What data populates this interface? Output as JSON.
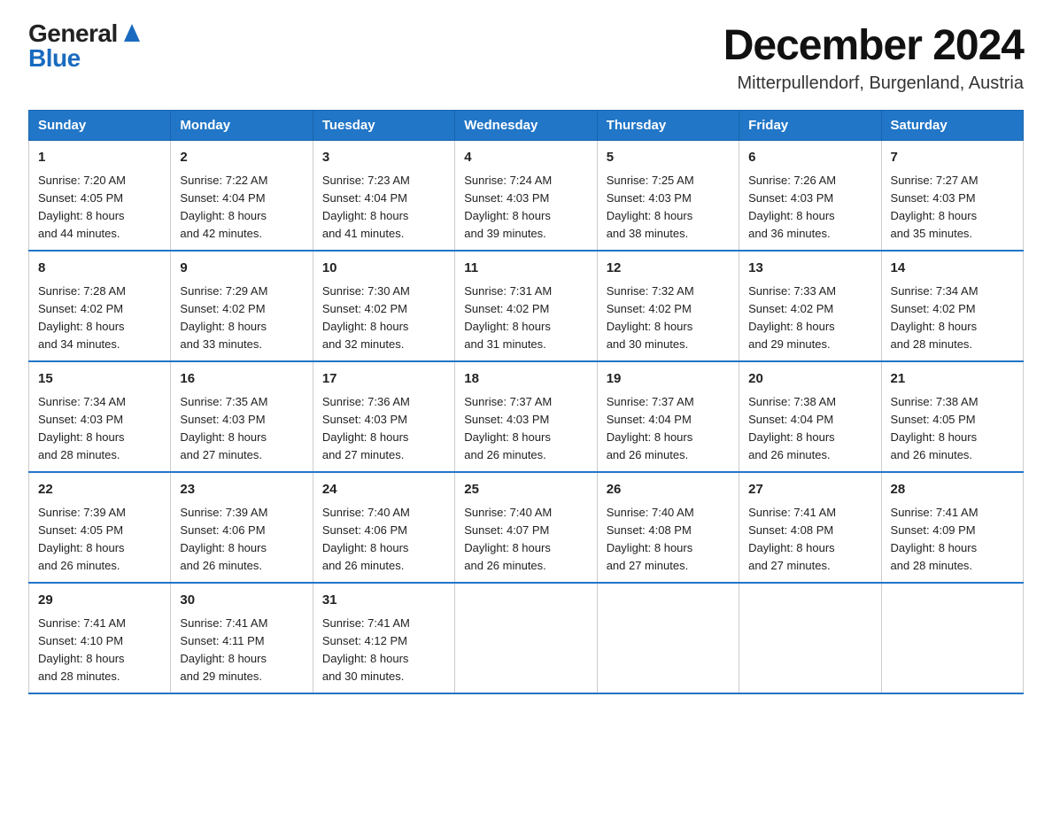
{
  "logo": {
    "general": "General",
    "blue": "Blue"
  },
  "title": "December 2024",
  "subtitle": "Mitterpullendorf, Burgenland, Austria",
  "weekdays": [
    "Sunday",
    "Monday",
    "Tuesday",
    "Wednesday",
    "Thursday",
    "Friday",
    "Saturday"
  ],
  "weeks": [
    [
      {
        "day": "1",
        "sunrise": "7:20 AM",
        "sunset": "4:05 PM",
        "daylight": "8 hours and 44 minutes."
      },
      {
        "day": "2",
        "sunrise": "7:22 AM",
        "sunset": "4:04 PM",
        "daylight": "8 hours and 42 minutes."
      },
      {
        "day": "3",
        "sunrise": "7:23 AM",
        "sunset": "4:04 PM",
        "daylight": "8 hours and 41 minutes."
      },
      {
        "day": "4",
        "sunrise": "7:24 AM",
        "sunset": "4:03 PM",
        "daylight": "8 hours and 39 minutes."
      },
      {
        "day": "5",
        "sunrise": "7:25 AM",
        "sunset": "4:03 PM",
        "daylight": "8 hours and 38 minutes."
      },
      {
        "day": "6",
        "sunrise": "7:26 AM",
        "sunset": "4:03 PM",
        "daylight": "8 hours and 36 minutes."
      },
      {
        "day": "7",
        "sunrise": "7:27 AM",
        "sunset": "4:03 PM",
        "daylight": "8 hours and 35 minutes."
      }
    ],
    [
      {
        "day": "8",
        "sunrise": "7:28 AM",
        "sunset": "4:02 PM",
        "daylight": "8 hours and 34 minutes."
      },
      {
        "day": "9",
        "sunrise": "7:29 AM",
        "sunset": "4:02 PM",
        "daylight": "8 hours and 33 minutes."
      },
      {
        "day": "10",
        "sunrise": "7:30 AM",
        "sunset": "4:02 PM",
        "daylight": "8 hours and 32 minutes."
      },
      {
        "day": "11",
        "sunrise": "7:31 AM",
        "sunset": "4:02 PM",
        "daylight": "8 hours and 31 minutes."
      },
      {
        "day": "12",
        "sunrise": "7:32 AM",
        "sunset": "4:02 PM",
        "daylight": "8 hours and 30 minutes."
      },
      {
        "day": "13",
        "sunrise": "7:33 AM",
        "sunset": "4:02 PM",
        "daylight": "8 hours and 29 minutes."
      },
      {
        "day": "14",
        "sunrise": "7:34 AM",
        "sunset": "4:02 PM",
        "daylight": "8 hours and 28 minutes."
      }
    ],
    [
      {
        "day": "15",
        "sunrise": "7:34 AM",
        "sunset": "4:03 PM",
        "daylight": "8 hours and 28 minutes."
      },
      {
        "day": "16",
        "sunrise": "7:35 AM",
        "sunset": "4:03 PM",
        "daylight": "8 hours and 27 minutes."
      },
      {
        "day": "17",
        "sunrise": "7:36 AM",
        "sunset": "4:03 PM",
        "daylight": "8 hours and 27 minutes."
      },
      {
        "day": "18",
        "sunrise": "7:37 AM",
        "sunset": "4:03 PM",
        "daylight": "8 hours and 26 minutes."
      },
      {
        "day": "19",
        "sunrise": "7:37 AM",
        "sunset": "4:04 PM",
        "daylight": "8 hours and 26 minutes."
      },
      {
        "day": "20",
        "sunrise": "7:38 AM",
        "sunset": "4:04 PM",
        "daylight": "8 hours and 26 minutes."
      },
      {
        "day": "21",
        "sunrise": "7:38 AM",
        "sunset": "4:05 PM",
        "daylight": "8 hours and 26 minutes."
      }
    ],
    [
      {
        "day": "22",
        "sunrise": "7:39 AM",
        "sunset": "4:05 PM",
        "daylight": "8 hours and 26 minutes."
      },
      {
        "day": "23",
        "sunrise": "7:39 AM",
        "sunset": "4:06 PM",
        "daylight": "8 hours and 26 minutes."
      },
      {
        "day": "24",
        "sunrise": "7:40 AM",
        "sunset": "4:06 PM",
        "daylight": "8 hours and 26 minutes."
      },
      {
        "day": "25",
        "sunrise": "7:40 AM",
        "sunset": "4:07 PM",
        "daylight": "8 hours and 26 minutes."
      },
      {
        "day": "26",
        "sunrise": "7:40 AM",
        "sunset": "4:08 PM",
        "daylight": "8 hours and 27 minutes."
      },
      {
        "day": "27",
        "sunrise": "7:41 AM",
        "sunset": "4:08 PM",
        "daylight": "8 hours and 27 minutes."
      },
      {
        "day": "28",
        "sunrise": "7:41 AM",
        "sunset": "4:09 PM",
        "daylight": "8 hours and 28 minutes."
      }
    ],
    [
      {
        "day": "29",
        "sunrise": "7:41 AM",
        "sunset": "4:10 PM",
        "daylight": "8 hours and 28 minutes."
      },
      {
        "day": "30",
        "sunrise": "7:41 AM",
        "sunset": "4:11 PM",
        "daylight": "8 hours and 29 minutes."
      },
      {
        "day": "31",
        "sunrise": "7:41 AM",
        "sunset": "4:12 PM",
        "daylight": "8 hours and 30 minutes."
      },
      null,
      null,
      null,
      null
    ]
  ]
}
